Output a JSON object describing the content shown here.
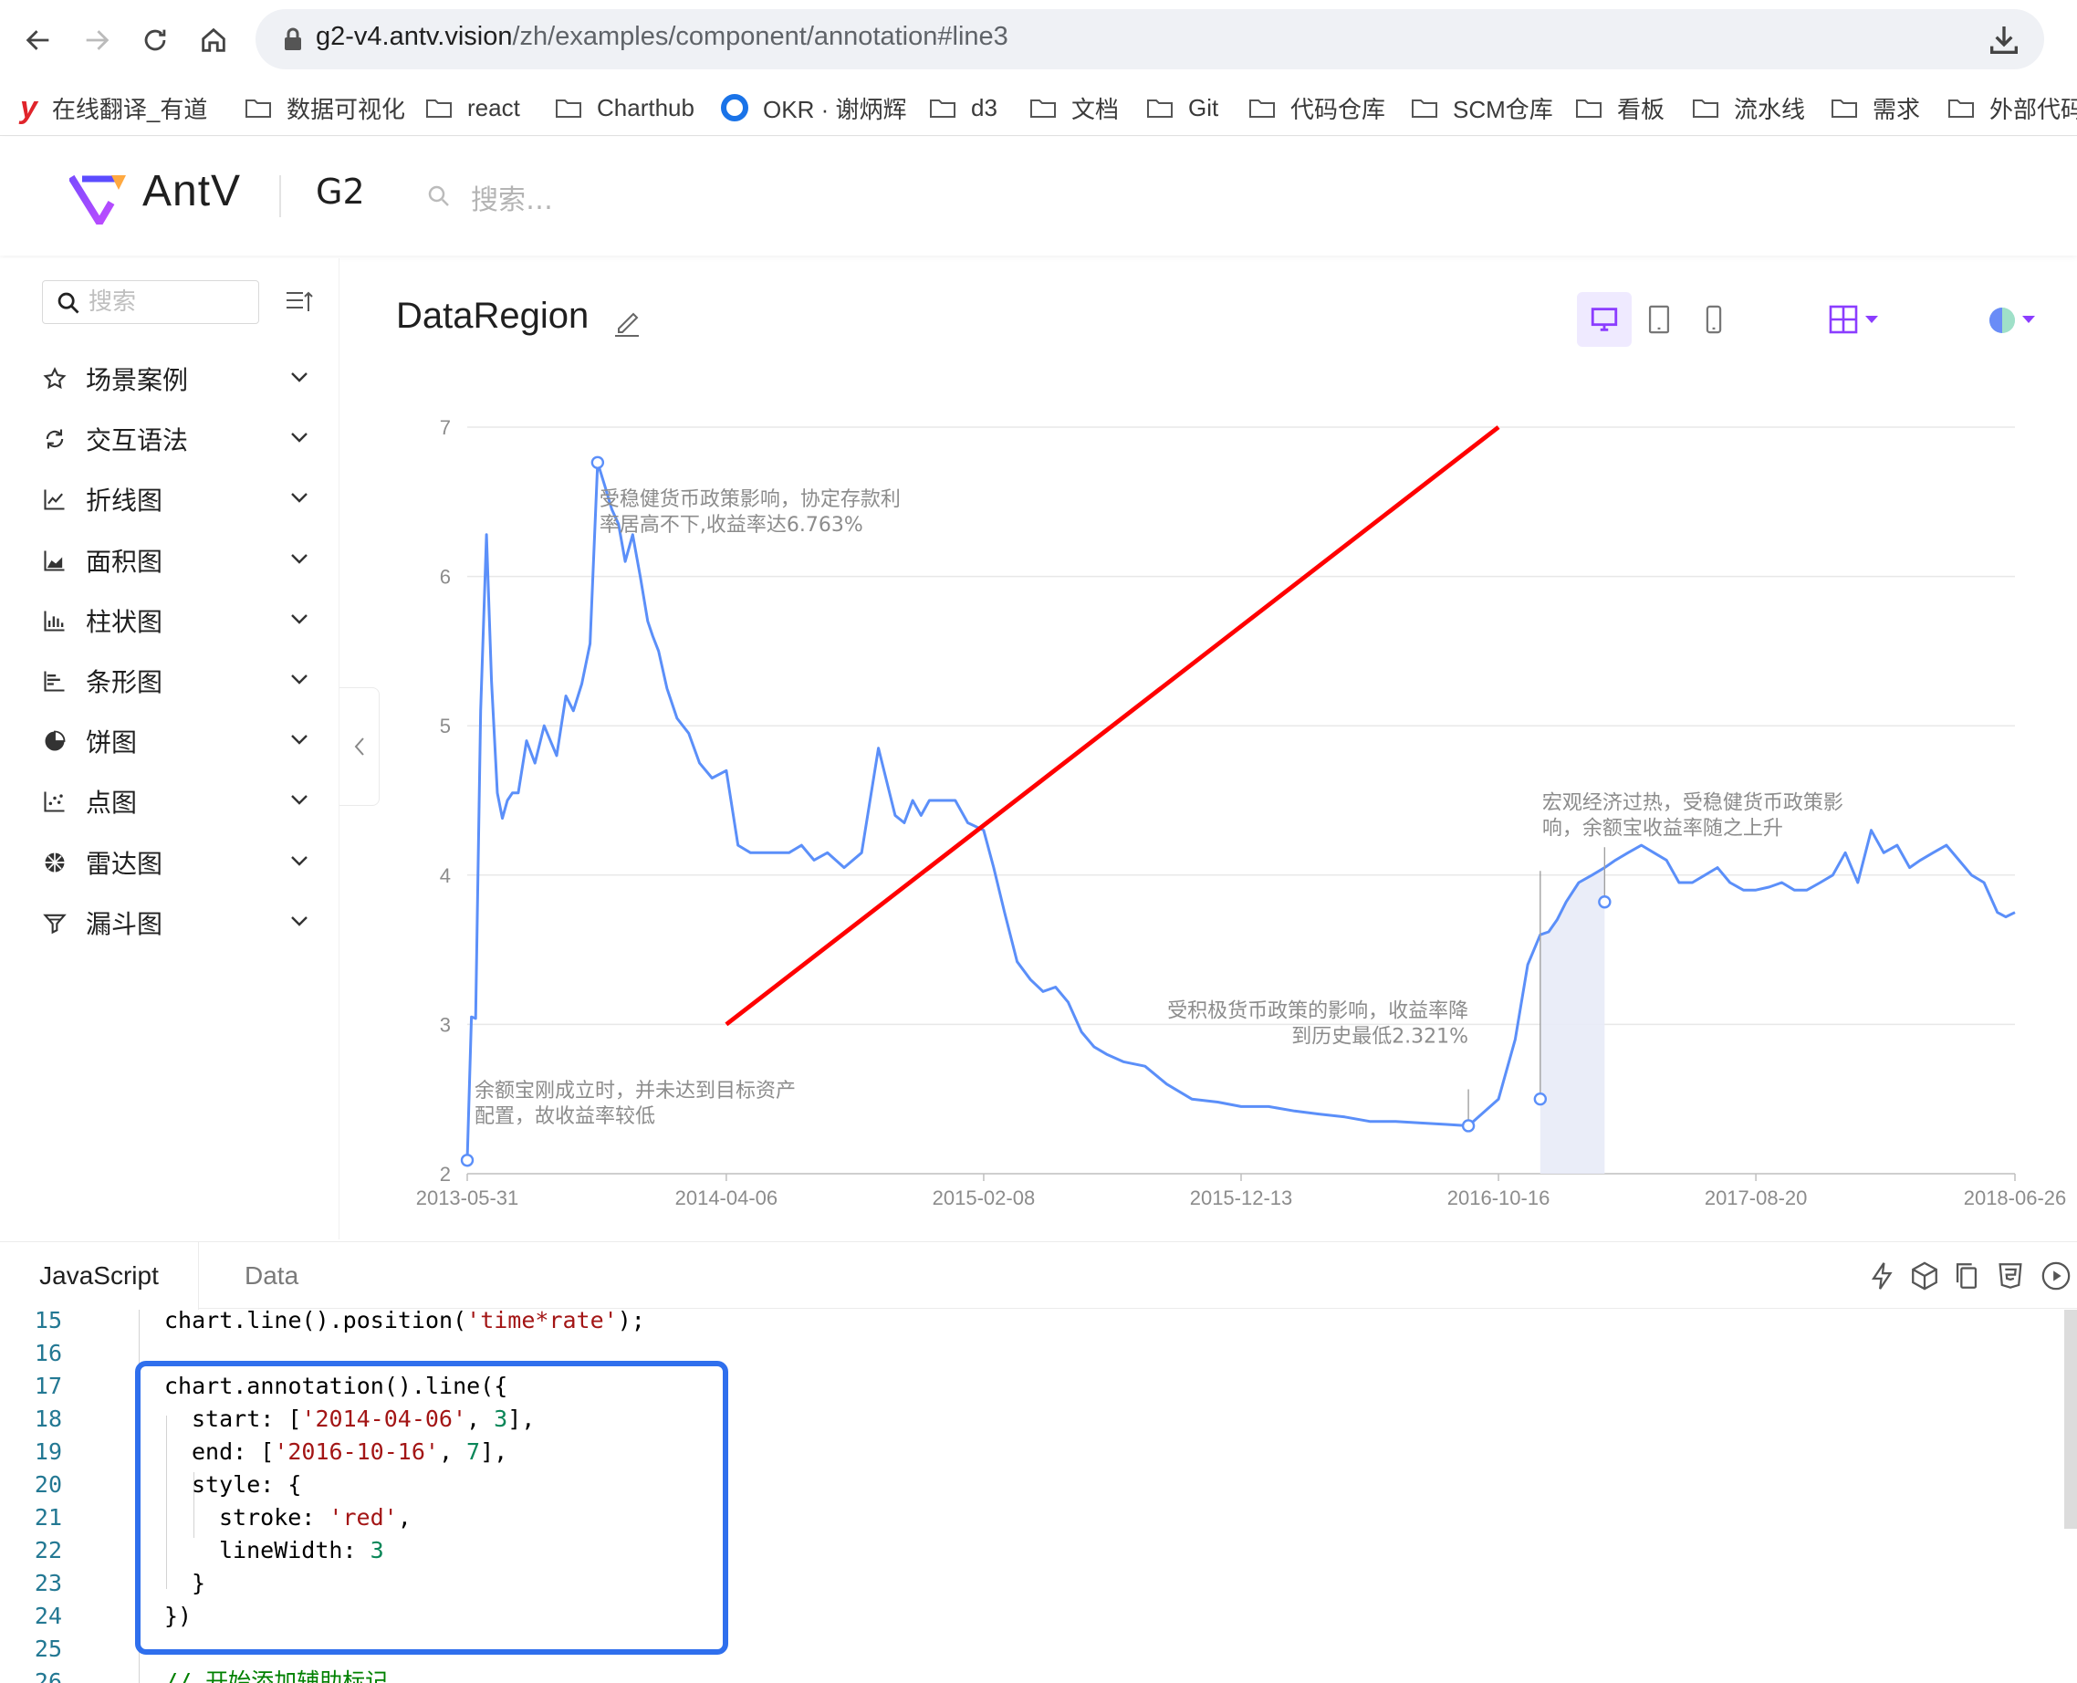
{
  "browser": {
    "url_host": "g2-v4.antv.vision",
    "url_path": "/zh/examples/component/annotation#line3",
    "bookmarks": [
      {
        "label": "在线翻译_有道",
        "kind": "youdao"
      },
      {
        "label": "数据可视化",
        "kind": "folder"
      },
      {
        "label": "react",
        "kind": "folder"
      },
      {
        "label": "Charthub",
        "kind": "folder"
      },
      {
        "label": "OKR · 谢炳辉",
        "kind": "okr"
      },
      {
        "label": "d3",
        "kind": "folder"
      },
      {
        "label": "文档",
        "kind": "folder"
      },
      {
        "label": "Git",
        "kind": "folder"
      },
      {
        "label": "代码仓库",
        "kind": "folder"
      },
      {
        "label": "SCM仓库",
        "kind": "folder"
      },
      {
        "label": "看板",
        "kind": "folder"
      },
      {
        "label": "流水线",
        "kind": "folder"
      },
      {
        "label": "需求",
        "kind": "folder"
      },
      {
        "label": "外部代码",
        "kind": "folder"
      }
    ]
  },
  "header": {
    "brand": "AntV",
    "product": "G2",
    "search_placeholder": "搜索…"
  },
  "sidebar": {
    "search_placeholder": "搜索",
    "items": [
      {
        "label": "场景案例",
        "icon": "star-icon"
      },
      {
        "label": "交互语法",
        "icon": "refresh-icon"
      },
      {
        "label": "折线图",
        "icon": "line-chart-icon"
      },
      {
        "label": "面积图",
        "icon": "area-chart-icon"
      },
      {
        "label": "柱状图",
        "icon": "column-chart-icon"
      },
      {
        "label": "条形图",
        "icon": "bar-chart-icon"
      },
      {
        "label": "饼图",
        "icon": "pie-chart-icon"
      },
      {
        "label": "点图",
        "icon": "dot-chart-icon"
      },
      {
        "label": "雷达图",
        "icon": "radar-chart-icon"
      },
      {
        "label": "漏斗图",
        "icon": "funnel-chart-icon"
      }
    ]
  },
  "main": {
    "title": "DataRegion"
  },
  "chart_data": {
    "type": "line",
    "title": "",
    "xlabel": "",
    "ylabel": "",
    "x_ticks": [
      "2013-05-31",
      "2014-04-06",
      "2015-02-08",
      "2015-12-13",
      "2016-10-16",
      "2017-08-20",
      "2018-06-26"
    ],
    "y_ticks": [
      2,
      3,
      4,
      5,
      6,
      7
    ],
    "ylim": [
      2,
      7
    ],
    "xlim": [
      "2013-05-31",
      "2018-06-26"
    ],
    "grid": true,
    "colors": {
      "line": "#5b8ff9",
      "annotation_line": "#ff0000",
      "region": "#e8ebf7",
      "grid": "#e8e8e8",
      "axis_label": "#8c8c8c",
      "annotation_text": "#8c8c8c"
    },
    "series": [
      {
        "x": [
          "2013-05-31",
          "2013-06-05",
          "2013-06-10",
          "2013-06-16",
          "2013-06-23",
          "2013-06-29",
          "2013-07-06",
          "2013-07-12",
          "2013-07-18",
          "2013-07-24",
          "2013-07-31",
          "2013-08-10",
          "2013-08-20",
          "2013-08-31",
          "2013-09-15",
          "2013-09-26",
          "2013-10-05",
          "2013-10-15",
          "2013-10-25",
          "2013-11-03",
          "2013-11-12",
          "2013-11-20",
          "2013-11-28",
          "2013-12-06",
          "2013-12-15",
          "2013-12-24",
          "2014-01-02",
          "2014-01-08",
          "2014-01-15",
          "2014-01-25",
          "2014-02-06",
          "2014-02-20",
          "2014-03-05",
          "2014-03-20",
          "2014-04-06",
          "2014-04-20",
          "2014-05-05",
          "2014-05-20",
          "2014-06-05",
          "2014-06-20",
          "2014-07-05",
          "2014-07-20",
          "2014-08-05",
          "2014-08-25",
          "2014-09-15",
          "2014-10-05",
          "2014-10-25",
          "2014-11-05",
          "2014-11-15",
          "2014-11-25",
          "2014-12-05",
          "2014-12-20",
          "2015-01-05",
          "2015-01-20",
          "2015-02-08",
          "2015-02-20",
          "2015-03-05",
          "2015-03-20",
          "2015-04-05",
          "2015-04-20",
          "2015-05-05",
          "2015-05-20",
          "2015-06-05",
          "2015-06-20",
          "2015-07-05",
          "2015-07-25",
          "2015-08-20",
          "2015-09-15",
          "2015-10-15",
          "2015-11-15",
          "2015-12-13",
          "2016-01-15",
          "2016-02-15",
          "2016-03-15",
          "2016-04-15",
          "2016-05-15",
          "2016-06-15",
          "2016-07-15",
          "2016-08-15",
          "2016-09-10",
          "2016-10-16",
          "2016-11-05",
          "2016-11-20",
          "2016-12-05",
          "2016-12-15",
          "2016-12-25",
          "2017-01-05",
          "2017-01-20",
          "2017-02-05",
          "2017-02-20",
          "2017-03-05",
          "2017-03-20",
          "2017-04-05",
          "2017-04-20",
          "2017-05-05",
          "2017-05-20",
          "2017-06-05",
          "2017-06-20",
          "2017-07-05",
          "2017-07-20",
          "2017-08-05",
          "2017-08-20",
          "2017-09-05",
          "2017-09-20",
          "2017-10-05",
          "2017-10-20",
          "2017-11-05",
          "2017-11-20",
          "2017-12-05",
          "2017-12-20",
          "2018-01-05",
          "2018-01-20",
          "2018-02-05",
          "2018-02-20",
          "2018-03-05",
          "2018-03-20",
          "2018-04-05",
          "2018-04-20",
          "2018-05-05",
          "2018-05-20",
          "2018-06-05",
          "2018-06-15",
          "2018-06-26"
        ],
        "values": [
          2.09,
          3.05,
          3.04,
          5.1,
          6.28,
          5.3,
          4.55,
          4.38,
          4.5,
          4.55,
          4.55,
          4.9,
          4.75,
          5.0,
          4.8,
          5.2,
          5.1,
          5.28,
          5.55,
          6.763,
          6.6,
          6.45,
          6.35,
          6.1,
          6.28,
          6.0,
          5.7,
          5.6,
          5.5,
          5.25,
          5.05,
          4.95,
          4.75,
          4.65,
          4.7,
          4.2,
          4.15,
          4.15,
          4.15,
          4.15,
          4.2,
          4.1,
          4.15,
          4.05,
          4.15,
          4.85,
          4.4,
          4.35,
          4.5,
          4.4,
          4.5,
          4.5,
          4.5,
          4.35,
          4.3,
          4.05,
          3.75,
          3.42,
          3.3,
          3.22,
          3.25,
          3.15,
          2.95,
          2.85,
          2.8,
          2.75,
          2.72,
          2.6,
          2.5,
          2.48,
          2.45,
          2.45,
          2.42,
          2.4,
          2.38,
          2.35,
          2.35,
          2.34,
          2.33,
          2.321,
          2.5,
          2.9,
          3.4,
          3.6,
          3.62,
          3.7,
          3.82,
          3.95,
          4.0,
          4.05,
          4.1,
          4.15,
          4.2,
          4.15,
          4.1,
          3.95,
          3.95,
          4.0,
          4.05,
          3.95,
          3.9,
          3.9,
          3.92,
          3.95,
          3.9,
          3.9,
          3.95,
          4.0,
          4.15,
          3.95,
          4.3,
          4.15,
          4.2,
          4.05,
          4.1,
          4.15,
          4.2,
          4.1,
          4.0,
          3.95,
          3.75,
          3.72,
          3.75
        ]
      }
    ],
    "annotations": {
      "line": {
        "start": [
          "2014-04-06",
          3
        ],
        "end": [
          "2016-10-16",
          7
        ],
        "stroke": "red",
        "lineWidth": 3
      },
      "region": {
        "start": [
          "2016-12-05",
          2
        ],
        "end": [
          "2017-02-20",
          7
        ],
        "label": "宏观经济过热"
      },
      "points": [
        {
          "x": "2013-05-31",
          "y": 2.09
        },
        {
          "x": "2013-11-03",
          "y": 6.763
        },
        {
          "x": "2016-09-10",
          "y": 2.321
        },
        {
          "x": "2016-12-05",
          "y": 2.5
        },
        {
          "x": "2017-02-20",
          "y": 3.82
        }
      ],
      "texts": [
        {
          "lines": [
            "余额宝刚成立时，并未达到目标资产",
            "配置，故收益率较低"
          ]
        },
        {
          "lines": [
            "受稳健货币政策影响，协定存款利",
            "率居高不下,收益率达6.763%"
          ]
        },
        {
          "lines": [
            "受积极货币政策的影响，收益率降",
            "到历史最低2.321%"
          ]
        },
        {
          "lines": [
            "宏观经济过热，受稳健货币政策影",
            "响，余额宝收益率随之上升"
          ]
        }
      ]
    }
  },
  "editor": {
    "tabs": [
      "JavaScript",
      "Data"
    ],
    "lines": [
      {
        "n": "15",
        "code": [
          [
            "chart.line().position(",
            ""
          ],
          [
            "'time*rate'",
            "str"
          ],
          [
            ");",
            ""
          ]
        ],
        "indent": 0
      },
      {
        "n": "16",
        "code": [],
        "indent": 0
      },
      {
        "n": "17",
        "code": [
          [
            "chart.annotation().line({",
            ""
          ]
        ],
        "indent": 0
      },
      {
        "n": "18",
        "code": [
          [
            "start: [",
            ""
          ],
          [
            "'2014-04-06'",
            "str"
          ],
          [
            ", ",
            ""
          ],
          [
            "3",
            "num"
          ],
          [
            "],",
            ""
          ]
        ],
        "indent": 1
      },
      {
        "n": "19",
        "code": [
          [
            "end: [",
            ""
          ],
          [
            "'2016-10-16'",
            "str"
          ],
          [
            ", ",
            ""
          ],
          [
            "7",
            "num"
          ],
          [
            "],",
            ""
          ]
        ],
        "indent": 1
      },
      {
        "n": "20",
        "code": [
          [
            "style: {",
            ""
          ]
        ],
        "indent": 1
      },
      {
        "n": "21",
        "code": [
          [
            "stroke: ",
            ""
          ],
          [
            "'red'",
            "str"
          ],
          [
            ",",
            ""
          ]
        ],
        "indent": 2
      },
      {
        "n": "22",
        "code": [
          [
            "lineWidth: ",
            ""
          ],
          [
            "3",
            "num"
          ]
        ],
        "indent": 2
      },
      {
        "n": "23",
        "code": [
          [
            "}",
            ""
          ]
        ],
        "indent": 1
      },
      {
        "n": "24",
        "code": [
          [
            "})",
            ""
          ]
        ],
        "indent": 0
      },
      {
        "n": "25",
        "code": [],
        "indent": 0
      },
      {
        "n": "26",
        "code": [
          [
            "// 开始添加辅助标记",
            "cmt"
          ]
        ],
        "indent": 0
      }
    ]
  }
}
